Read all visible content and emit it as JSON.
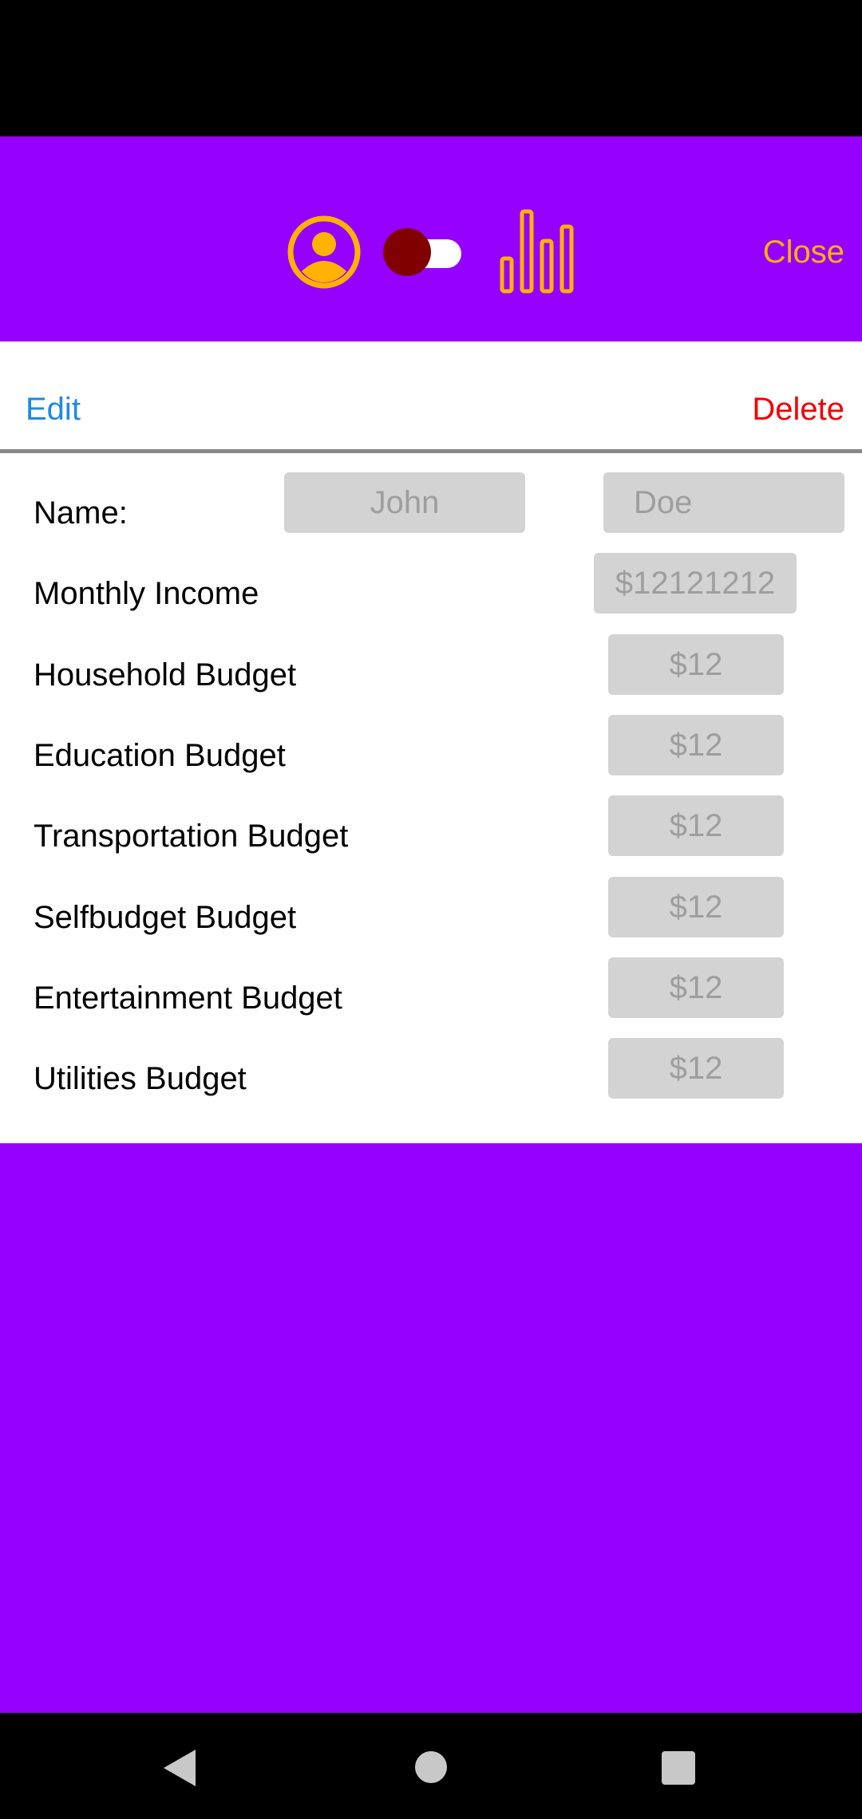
{
  "header": {
    "profile_icon": "account-circle-icon",
    "chart_icon": "bar-chart-icon",
    "close_label": "Close",
    "accent_color": "#FFB300",
    "background_color": "#9600FF",
    "toggle_on": false
  },
  "actions": {
    "edit_label": "Edit",
    "delete_label": "Delete"
  },
  "form": {
    "name_label": "Name:",
    "first_name_placeholder": "John",
    "last_name_placeholder": "Doe",
    "income_label": "Monthly Income",
    "income_placeholder": "$12121212",
    "budgets": [
      {
        "label": "Household Budget",
        "placeholder": "$12"
      },
      {
        "label": "Education Budget",
        "placeholder": "$12"
      },
      {
        "label": "Transportation Budget",
        "placeholder": "$12"
      },
      {
        "label": "Selfbudget Budget",
        "placeholder": "$12"
      },
      {
        "label": "Entertainment Budget",
        "placeholder": "$12"
      },
      {
        "label": "Utilities Budget",
        "placeholder": "$12"
      }
    ]
  },
  "nav": {
    "back_icon": "back-triangle-icon",
    "home_icon": "home-circle-icon",
    "recents_icon": "recents-square-icon"
  }
}
